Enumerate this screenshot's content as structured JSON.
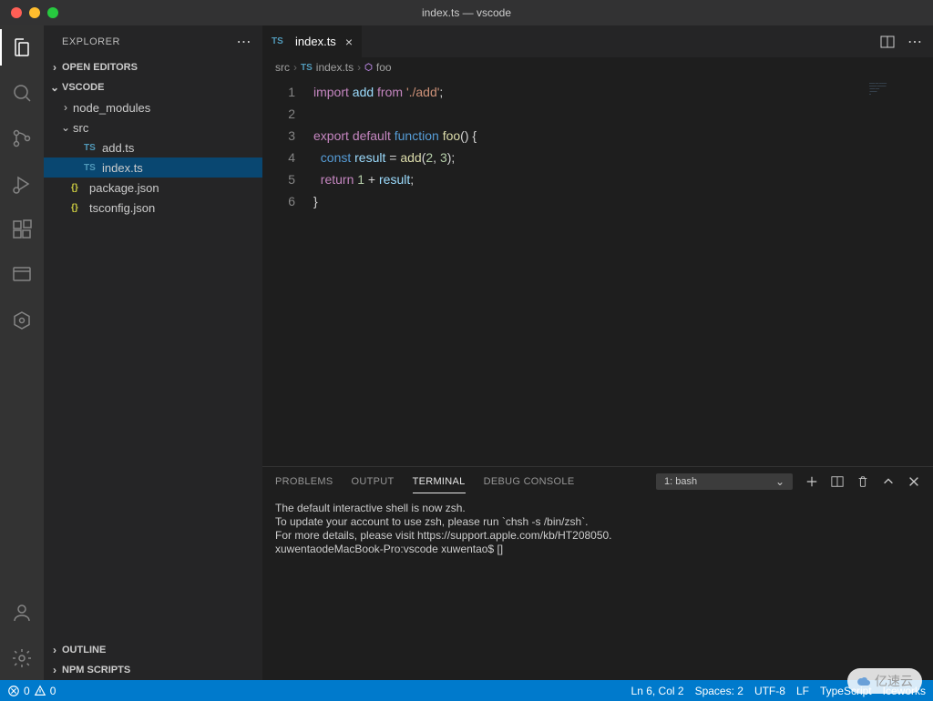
{
  "window": {
    "title": "index.ts — vscode"
  },
  "sidebar": {
    "title": "EXPLORER",
    "sections": {
      "open_editors": "OPEN EDITORS",
      "workspace": "VSCODE",
      "outline": "OUTLINE",
      "npm": "NPM SCRIPTS"
    },
    "tree": {
      "node_modules": "node_modules",
      "src": "src",
      "add_ts": "add.ts",
      "index_ts": "index.ts",
      "package_json": "package.json",
      "tsconfig_json": "tsconfig.json"
    }
  },
  "tab": {
    "label": "index.ts"
  },
  "breadcrumbs": {
    "p0": "src",
    "p1": "index.ts",
    "p2": "foo"
  },
  "code": {
    "l1": {
      "import": "import",
      "add": "add",
      "from": "from",
      "path": "'./add'",
      "semi": ";"
    },
    "l3": {
      "export": "export",
      "default": "default",
      "function": "function",
      "foo": "foo",
      "parens": "()",
      "brace": "{"
    },
    "l4": {
      "const": "const",
      "result": "result",
      "eq": " = ",
      "add": "add",
      "open": "(",
      "n2": "2",
      "comma": ", ",
      "n3": "3",
      "close": ");"
    },
    "l5": {
      "return": "return",
      "one": "1",
      "plus": " + ",
      "result": "result",
      "semi": ";"
    },
    "l6": {
      "brace": "}"
    },
    "line_numbers": [
      "1",
      "2",
      "3",
      "4",
      "5",
      "6"
    ]
  },
  "panel": {
    "tabs": {
      "problems": "PROBLEMS",
      "output": "OUTPUT",
      "terminal": "TERMINAL",
      "debug": "DEBUG CONSOLE"
    },
    "terminal_select": "1: bash",
    "terminal_lines": [
      "The default interactive shell is now zsh.",
      "To update your account to use zsh, please run `chsh -s /bin/zsh`.",
      "For more details, please visit https://support.apple.com/kb/HT208050.",
      "xuwentaodeMacBook-Pro:vscode xuwentao$ []"
    ]
  },
  "status": {
    "errors": "0",
    "warnings": "0",
    "ln_col": "Ln 6, Col 2",
    "spaces": "Spaces: 2",
    "encoding": "UTF-8",
    "eol": "LF",
    "language": "TypeScript",
    "ext": "Iceworks"
  },
  "watermark": "亿速云"
}
